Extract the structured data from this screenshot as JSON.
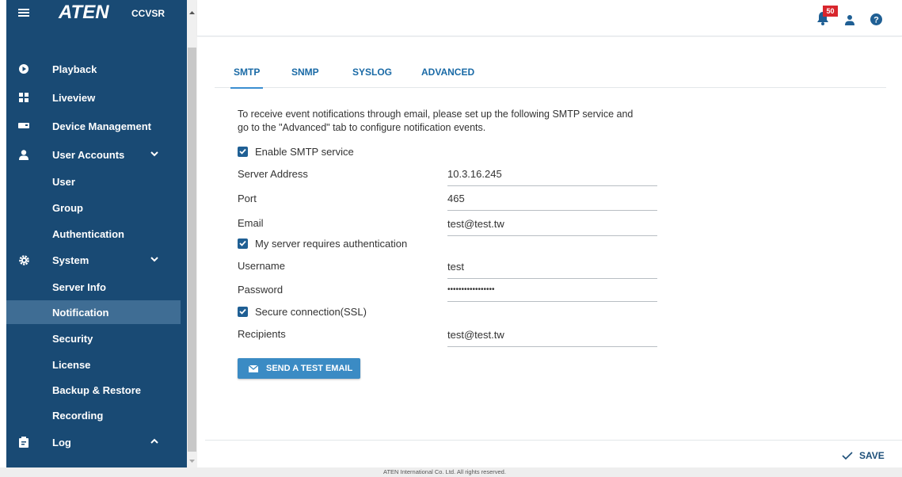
{
  "sidebar": {
    "logo": "ATEN",
    "logo_sub": "CCVSR",
    "items": [
      {
        "label": "Playback"
      },
      {
        "label": "Liveview"
      },
      {
        "label": "Device Management"
      },
      {
        "label": "User Accounts"
      },
      {
        "label": "User"
      },
      {
        "label": "Group"
      },
      {
        "label": "Authentication"
      },
      {
        "label": "System"
      },
      {
        "label": "Server Info"
      },
      {
        "label": "Notification",
        "active": true
      },
      {
        "label": "Security"
      },
      {
        "label": "License"
      },
      {
        "label": "Backup & Restore"
      },
      {
        "label": "Recording"
      },
      {
        "label": "Log"
      }
    ]
  },
  "header": {
    "notification_count": "50",
    "icons": [
      "bell-icon",
      "user-icon",
      "help-icon"
    ]
  },
  "tabs": [
    {
      "label": "SMTP",
      "active": true
    },
    {
      "label": "SNMP"
    },
    {
      "label": "SYSLOG"
    },
    {
      "label": "ADVANCED"
    }
  ],
  "smtp": {
    "intro_line1": "To receive event notifications through email, please set up the following SMTP service and",
    "intro_line2": "go to the \"Advanced\" tab to configure notification events.",
    "enable_label": "Enable SMTP service",
    "server_address_label": "Server Address",
    "server_address_value": "10.3.16.245",
    "port_label": "Port",
    "port_value": "465",
    "email_label": "Email",
    "email_value": "test@test.tw",
    "auth_label": "My server requires authentication",
    "username_label": "Username",
    "username_value": "test",
    "password_label": "Password",
    "password_value": "•••••••••••••••••",
    "ssl_label": "Secure connection(SSL)",
    "recipients_label": "Recipients",
    "recipients_value": "test@test.tw",
    "test_button": "SEND A TEST EMAIL",
    "enable_checked": true,
    "auth_checked": true,
    "ssl_checked": true
  },
  "save_label": "SAVE",
  "footer": "ATEN International Co. Ltd. All rights reserved.",
  "colors": {
    "sidebar_bg": "#194a74",
    "sidebar_active": "#3f6d94",
    "accent": "#3b8bc4",
    "badge": "#d8262d"
  }
}
